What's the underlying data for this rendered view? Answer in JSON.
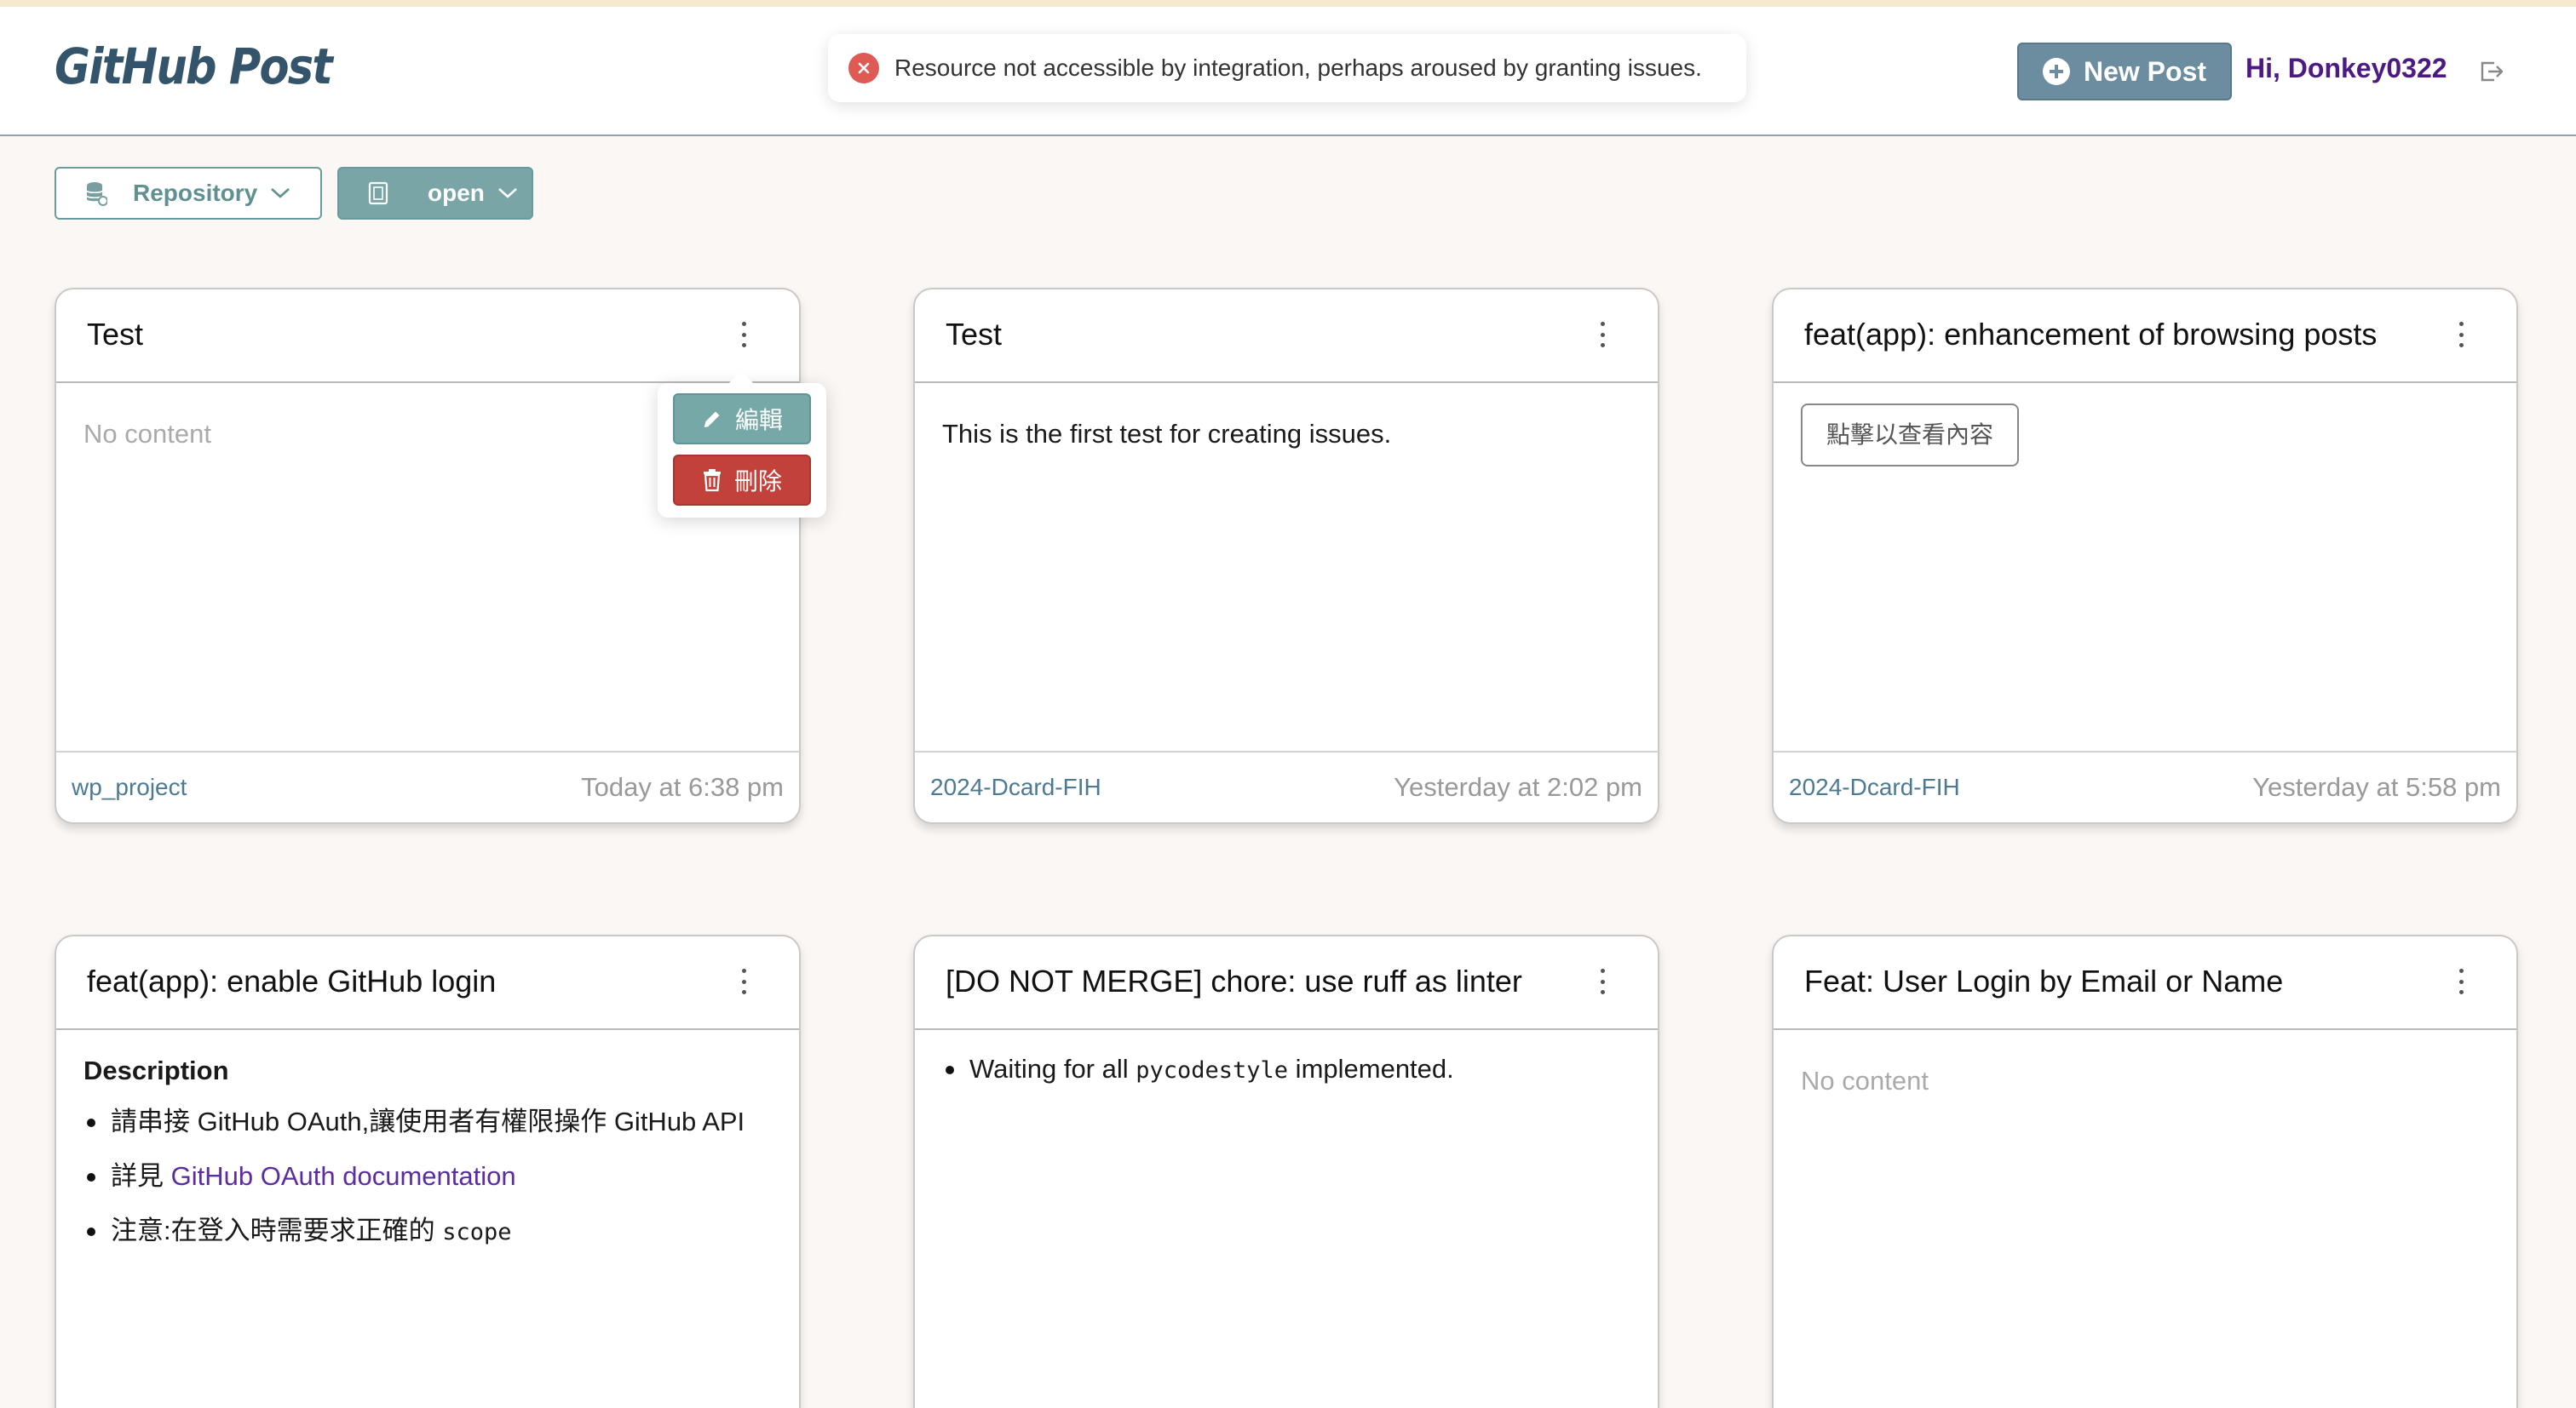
{
  "app": {
    "title": "GitHub Post"
  },
  "toast": {
    "message": "Resource not accessible by integration, perhaps aroused by granting issues.",
    "icon": "error-x-icon",
    "color": "#e05a55"
  },
  "header": {
    "new_post_label": "New Post",
    "greeting": "Hi, Donkey0322"
  },
  "filters": {
    "repository_label": "Repository",
    "state_label": "open"
  },
  "menu": {
    "edit_label": "編輯",
    "delete_label": "刪除"
  },
  "cards": [
    {
      "title": "Test",
      "body": "No content",
      "repo": "wp_project",
      "time": "Today at 6:38 pm"
    },
    {
      "title": "Test",
      "body": "This is the first test for creating issues.",
      "repo": "2024-Dcard-FIH",
      "time": "Yesterday at 2:02 pm"
    },
    {
      "title": "feat(app): enhancement of browsing posts",
      "button": "點擊以查看內容",
      "repo": "2024-Dcard-FIH",
      "time": "Yesterday at 5:58 pm"
    },
    {
      "title": "feat(app): enable GitHub login",
      "heading": "Description",
      "items": [
        {
          "text": "請串接 GitHub OAuth,讓使用者有權限操作 GitHub API"
        },
        {
          "prefix": "詳見 ",
          "link": "GitHub OAuth documentation"
        },
        {
          "prefix": "注意:在登入時需要求正確的 ",
          "code": "scope"
        }
      ]
    },
    {
      "title": "[DO NOT MERGE] chore: use ruff as linter",
      "items": [
        {
          "prefix": "Waiting for all ",
          "code": "pycodestyle",
          "suffix": " implemented."
        }
      ]
    },
    {
      "title": "Feat: User Login by Email or Name",
      "body": "No content"
    }
  ],
  "colors": {
    "brand": "#33546a",
    "accent": "#6b8d9f",
    "teal": "#7aa5a6",
    "danger": "#c3413b",
    "greeting": "#4d1a83"
  }
}
